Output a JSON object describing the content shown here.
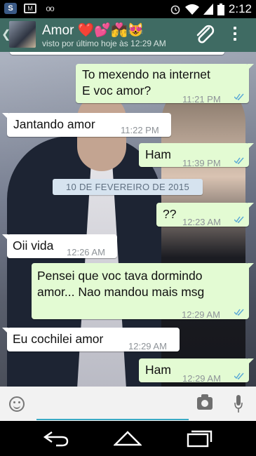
{
  "status_bar": {
    "left_icons": [
      "shield-icon",
      "mail-icon",
      "voicemail-icon"
    ],
    "right_icons": [
      "alarm-icon",
      "wifi-icon",
      "signal-icon",
      "battery-icon"
    ],
    "time": "2:12"
  },
  "header": {
    "contact_name": "Amor ❤️💕💏😻",
    "status": "visto por último hoje às 12:29 AM",
    "accent_color": "#3f6b63"
  },
  "messages": [
    {
      "direction": "out",
      "text": "To mexendo na internet\nE voc amor?",
      "time": "11:21 PM",
      "ticks": "read"
    },
    {
      "direction": "in",
      "text": "Jantando amor",
      "time": "11:22 PM"
    },
    {
      "direction": "out",
      "text": "Ham",
      "time": "11:39 PM",
      "ticks": "read"
    },
    {
      "direction": "out",
      "text": "??",
      "time": "12:23 AM",
      "ticks": "read"
    },
    {
      "direction": "in",
      "text": "Oii vida",
      "time": "12:26 AM"
    },
    {
      "direction": "out",
      "text": "Pensei que voc tava dormindo\namor... Nao mandou mais msg",
      "time": "12:29 AM",
      "ticks": "read"
    },
    {
      "direction": "in",
      "text": "Eu cochilei amor",
      "time": "12:29 AM"
    },
    {
      "direction": "out",
      "text": "Ham",
      "time": "12:29 AM",
      "ticks": "read"
    }
  ],
  "date_divider": "10 DE FEVEREIRO DE 2015",
  "input_bar": {
    "value": "",
    "placeholder": ""
  },
  "nav_bar": {
    "buttons": [
      "back-icon",
      "home-icon",
      "recents-icon"
    ]
  }
}
